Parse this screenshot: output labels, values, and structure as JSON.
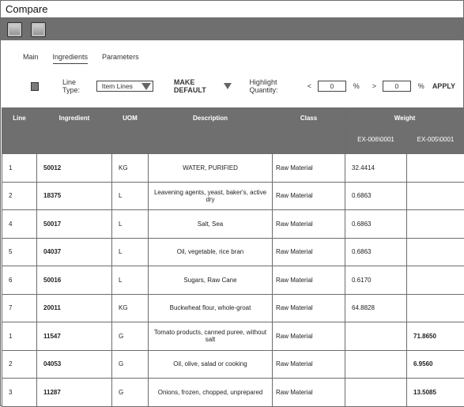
{
  "window": {
    "title": "Compare"
  },
  "tabs": [
    {
      "label": "Main",
      "active": false
    },
    {
      "label": "Ingredients",
      "active": true
    },
    {
      "label": "Parameters",
      "active": false
    }
  ],
  "controls": {
    "line_type_label": "Line Type:",
    "line_type_value": "Item Lines",
    "make_default_label": "MAKE DEFAULT",
    "highlight_label": "Highlight Quantity:",
    "lt_symbol": "<",
    "lt_value": "0",
    "gt_symbol": ">",
    "gt_value": "0",
    "percent_symbol": "%",
    "apply_label": "APPLY"
  },
  "table": {
    "headers": {
      "line": "Line",
      "ingredient": "Ingredient",
      "uom": "UOM",
      "description": "Description",
      "class": "Class",
      "weight": "Weight",
      "weight_col1": "EX-006\\0001",
      "weight_col2": "EX-005\\0001"
    },
    "rows": [
      {
        "line": "1",
        "ingredient": "50012",
        "uom": "KG",
        "description": "WATER, PURIFIED",
        "class": "Raw Material",
        "w1": "32.4414",
        "w2": ""
      },
      {
        "line": "2",
        "ingredient": "18375",
        "uom": "L",
        "description": "Leavening agents, yeast, baker's, active dry",
        "class": "Raw Material",
        "w1": "0.6863",
        "w2": ""
      },
      {
        "line": "4",
        "ingredient": "50017",
        "uom": "L",
        "description": "Salt, Sea",
        "class": "Raw Material",
        "w1": "0.6863",
        "w2": ""
      },
      {
        "line": "5",
        "ingredient": "04037",
        "uom": "L",
        "description": "Oil, vegetable, rice bran",
        "class": "Raw Material",
        "w1": "0.6863",
        "w2": ""
      },
      {
        "line": "6",
        "ingredient": "50016",
        "uom": "L",
        "description": "Sugars, Raw Cane",
        "class": "Raw Material",
        "w1": "0.6170",
        "w2": ""
      },
      {
        "line": "7",
        "ingredient": "20011",
        "uom": "KG",
        "description": "Buckwheat flour, whole-groat",
        "class": "Raw Material",
        "w1": "64.8828",
        "w2": ""
      },
      {
        "line": "1",
        "ingredient": "11547",
        "uom": "G",
        "description": "Tomato products, canned puree, without salt",
        "class": "Raw Material",
        "w1": "",
        "w2": "71.8650"
      },
      {
        "line": "2",
        "ingredient": "04053",
        "uom": "G",
        "description": "Oil, olive, salad or cooking",
        "class": "Raw Material",
        "w1": "",
        "w2": "6.9560"
      },
      {
        "line": "3",
        "ingredient": "11287",
        "uom": "G",
        "description": "Onions, frozen, chopped, unprepared",
        "class": "Raw Material",
        "w1": "",
        "w2": "13.5085"
      }
    ]
  }
}
